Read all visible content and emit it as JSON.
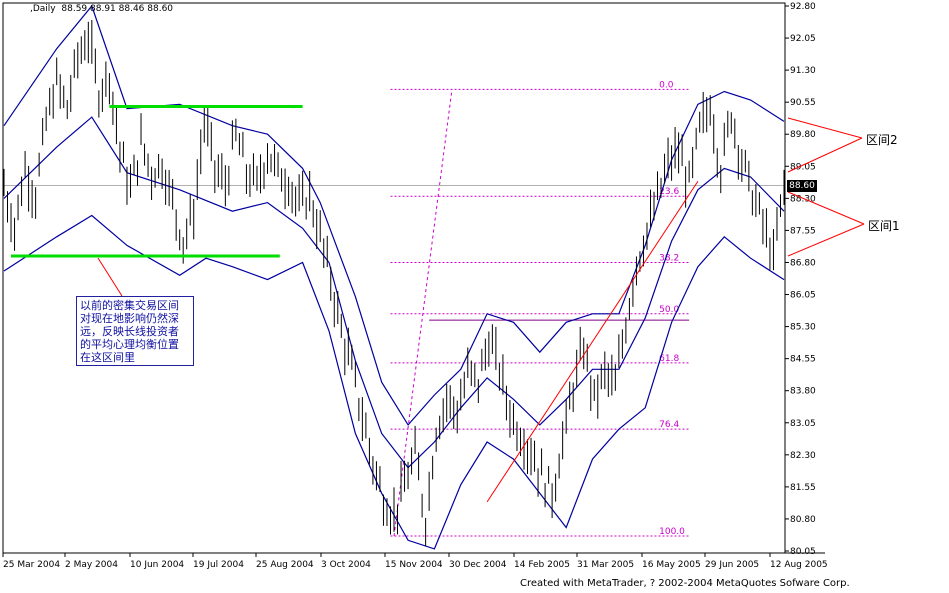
{
  "header": {
    "period": ",Daily",
    "ohlc": "88.59 88.91 88.46 88.60"
  },
  "current_price": "88.60",
  "note_text": "以前的密集交易区间\n对现在地影响仍然深\n远，反映长线投资者\n的平均心理均衡位置\n在这区间里",
  "callouts": {
    "zone2": "区间2",
    "zone1": "区间1"
  },
  "credit": "Created with MetaTrader, ? 2002-2004 MetaQuotes Sofware Corp.",
  "colors": {
    "bars": "#000000",
    "bands": "#0000a0",
    "support_resistance": "#00dd00",
    "fibonacci": "#cc00cc",
    "trendline": "#ff0000",
    "callout_lines": "#ff0000"
  },
  "chart_data": {
    "type": "ohlc",
    "ylim": [
      80.05,
      92.8
    ],
    "y_ticks": [
      "92.80",
      "92.05",
      "91.30",
      "90.55",
      "89.80",
      "89.05",
      "88.30",
      "87.55",
      "86.80",
      "86.05",
      "85.30",
      "84.55",
      "83.80",
      "83.05",
      "82.30",
      "81.55",
      "80.80",
      "80.05"
    ],
    "x_ticks": [
      "25 Mar 2004",
      "2 May 2004",
      "10 Jun 2004",
      "19 Jul 2004",
      "25 Aug 2004",
      "3 Oct 2004",
      "15 Nov 2004",
      "30 Dec 2004",
      "14 Feb 2005",
      "31 Mar 2005",
      "16 May 2005",
      "29 Jun 2005",
      "12 Aug 2005"
    ],
    "price_path": [
      [
        0,
        88.6
      ],
      [
        6,
        87.6
      ],
      [
        12,
        89.0
      ],
      [
        18,
        88.4
      ],
      [
        24,
        90.1
      ],
      [
        30,
        91.0
      ],
      [
        36,
        90.4
      ],
      [
        42,
        91.6
      ],
      [
        48,
        92.1
      ],
      [
        54,
        90.8
      ],
      [
        60,
        91.2
      ],
      [
        66,
        89.4
      ],
      [
        72,
        88.5
      ],
      [
        78,
        89.6
      ],
      [
        84,
        88.9
      ],
      [
        90,
        89.1
      ],
      [
        96,
        88.2
      ],
      [
        102,
        87.3
      ],
      [
        108,
        88.0
      ],
      [
        114,
        90.1
      ],
      [
        120,
        89.0
      ],
      [
        126,
        88.6
      ],
      [
        132,
        89.8
      ],
      [
        138,
        88.9
      ],
      [
        144,
        88.6
      ],
      [
        150,
        89.4
      ],
      [
        156,
        88.9
      ],
      [
        162,
        88.7
      ],
      [
        168,
        88.1
      ],
      [
        174,
        88.4
      ],
      [
        180,
        87.4
      ],
      [
        186,
        86.4
      ],
      [
        192,
        85.2
      ],
      [
        198,
        84.3
      ],
      [
        204,
        83.2
      ],
      [
        210,
        82.1
      ],
      [
        216,
        81.3
      ],
      [
        222,
        80.9
      ],
      [
        228,
        81.6
      ],
      [
        234,
        82.3
      ],
      [
        240,
        80.8
      ],
      [
        246,
        82.9
      ],
      [
        252,
        83.6
      ],
      [
        258,
        83.3
      ],
      [
        264,
        84.2
      ],
      [
        270,
        84.0
      ],
      [
        276,
        85.0
      ],
      [
        282,
        84.3
      ],
      [
        288,
        83.3
      ],
      [
        294,
        82.8
      ],
      [
        300,
        82.4
      ],
      [
        306,
        81.8
      ],
      [
        312,
        81.4
      ],
      [
        318,
        82.6
      ],
      [
        324,
        83.9
      ],
      [
        330,
        84.8
      ],
      [
        336,
        83.6
      ],
      [
        342,
        84.2
      ],
      [
        348,
        83.9
      ],
      [
        354,
        85.4
      ],
      [
        360,
        86.8
      ],
      [
        366,
        87.5
      ],
      [
        372,
        88.3
      ],
      [
        378,
        89.1
      ],
      [
        384,
        89.4
      ],
      [
        390,
        88.6
      ],
      [
        396,
        89.9
      ],
      [
        402,
        90.5
      ],
      [
        408,
        89.0
      ],
      [
        414,
        90.3
      ],
      [
        420,
        89.2
      ],
      [
        426,
        88.4
      ],
      [
        432,
        87.7
      ],
      [
        438,
        86.9
      ],
      [
        444,
        88.6
      ]
    ],
    "bollinger_upper": [
      [
        0,
        90.0
      ],
      [
        30,
        91.8
      ],
      [
        50,
        92.8
      ],
      [
        70,
        90.4
      ],
      [
        100,
        90.5
      ],
      [
        130,
        90.0
      ],
      [
        150,
        89.8
      ],
      [
        170,
        89.0
      ],
      [
        180,
        88.2
      ],
      [
        200,
        86.0
      ],
      [
        215,
        84.0
      ],
      [
        230,
        83.0
      ],
      [
        245,
        83.7
      ],
      [
        260,
        84.3
      ],
      [
        275,
        85.6
      ],
      [
        290,
        85.4
      ],
      [
        305,
        84.7
      ],
      [
        320,
        85.4
      ],
      [
        335,
        85.6
      ],
      [
        350,
        85.6
      ],
      [
        365,
        87.2
      ],
      [
        380,
        89.2
      ],
      [
        395,
        90.5
      ],
      [
        410,
        90.8
      ],
      [
        425,
        90.6
      ],
      [
        444,
        90.1
      ]
    ],
    "bollinger_middle": [
      [
        0,
        88.3
      ],
      [
        30,
        89.5
      ],
      [
        50,
        90.2
      ],
      [
        70,
        88.9
      ],
      [
        100,
        88.5
      ],
      [
        130,
        88.0
      ],
      [
        150,
        88.2
      ],
      [
        170,
        87.6
      ],
      [
        185,
        86.8
      ],
      [
        200,
        84.5
      ],
      [
        215,
        82.8
      ],
      [
        230,
        82.0
      ],
      [
        245,
        82.6
      ],
      [
        260,
        83.4
      ],
      [
        275,
        84.1
      ],
      [
        290,
        83.6
      ],
      [
        305,
        83.0
      ],
      [
        320,
        83.6
      ],
      [
        335,
        84.3
      ],
      [
        350,
        84.3
      ],
      [
        365,
        85.5
      ],
      [
        380,
        87.3
      ],
      [
        395,
        88.5
      ],
      [
        410,
        89.0
      ],
      [
        425,
        88.8
      ],
      [
        444,
        88.0
      ]
    ],
    "bollinger_lower": [
      [
        0,
        86.6
      ],
      [
        30,
        87.4
      ],
      [
        50,
        87.9
      ],
      [
        70,
        87.2
      ],
      [
        100,
        86.5
      ],
      [
        115,
        86.9
      ],
      [
        130,
        86.7
      ],
      [
        150,
        86.4
      ],
      [
        170,
        86.8
      ],
      [
        185,
        85.2
      ],
      [
        200,
        82.8
      ],
      [
        215,
        81.4
      ],
      [
        230,
        80.3
      ],
      [
        245,
        80.1
      ],
      [
        260,
        81.6
      ],
      [
        275,
        82.6
      ],
      [
        290,
        82.2
      ],
      [
        305,
        81.4
      ],
      [
        320,
        80.6
      ],
      [
        335,
        82.2
      ],
      [
        350,
        82.9
      ],
      [
        365,
        83.4
      ],
      [
        380,
        85.4
      ],
      [
        395,
        86.7
      ],
      [
        410,
        87.4
      ],
      [
        425,
        86.9
      ],
      [
        444,
        86.4
      ]
    ],
    "support_lines": [
      {
        "x0": 60,
        "x1": 170,
        "y": 90.45
      },
      {
        "x0": 4,
        "x1": 157,
        "y": 86.95
      }
    ],
    "fibonacci": {
      "x0": 220,
      "x1": 390,
      "levels": [
        {
          "label": "0.0",
          "y": 90.85
        },
        {
          "label": "23.6",
          "y": 88.35
        },
        {
          "label": "38.2",
          "y": 86.8
        },
        {
          "label": "50.0",
          "y": 85.6
        },
        {
          "label": "61.8",
          "y": 84.45
        },
        {
          "label": "76.4",
          "y": 82.9
        },
        {
          "label": "100.0",
          "y": 80.4
        }
      ],
      "diagonal": [
        [
          222,
          80.4
        ],
        [
          255,
          90.85
        ]
      ]
    },
    "horizontal_line": {
      "x0": 242,
      "x1": 390,
      "y": 85.45
    },
    "trendline": [
      [
        275,
        81.2
      ],
      [
        395,
        88.7
      ]
    ],
    "current_line_y": 88.6
  }
}
